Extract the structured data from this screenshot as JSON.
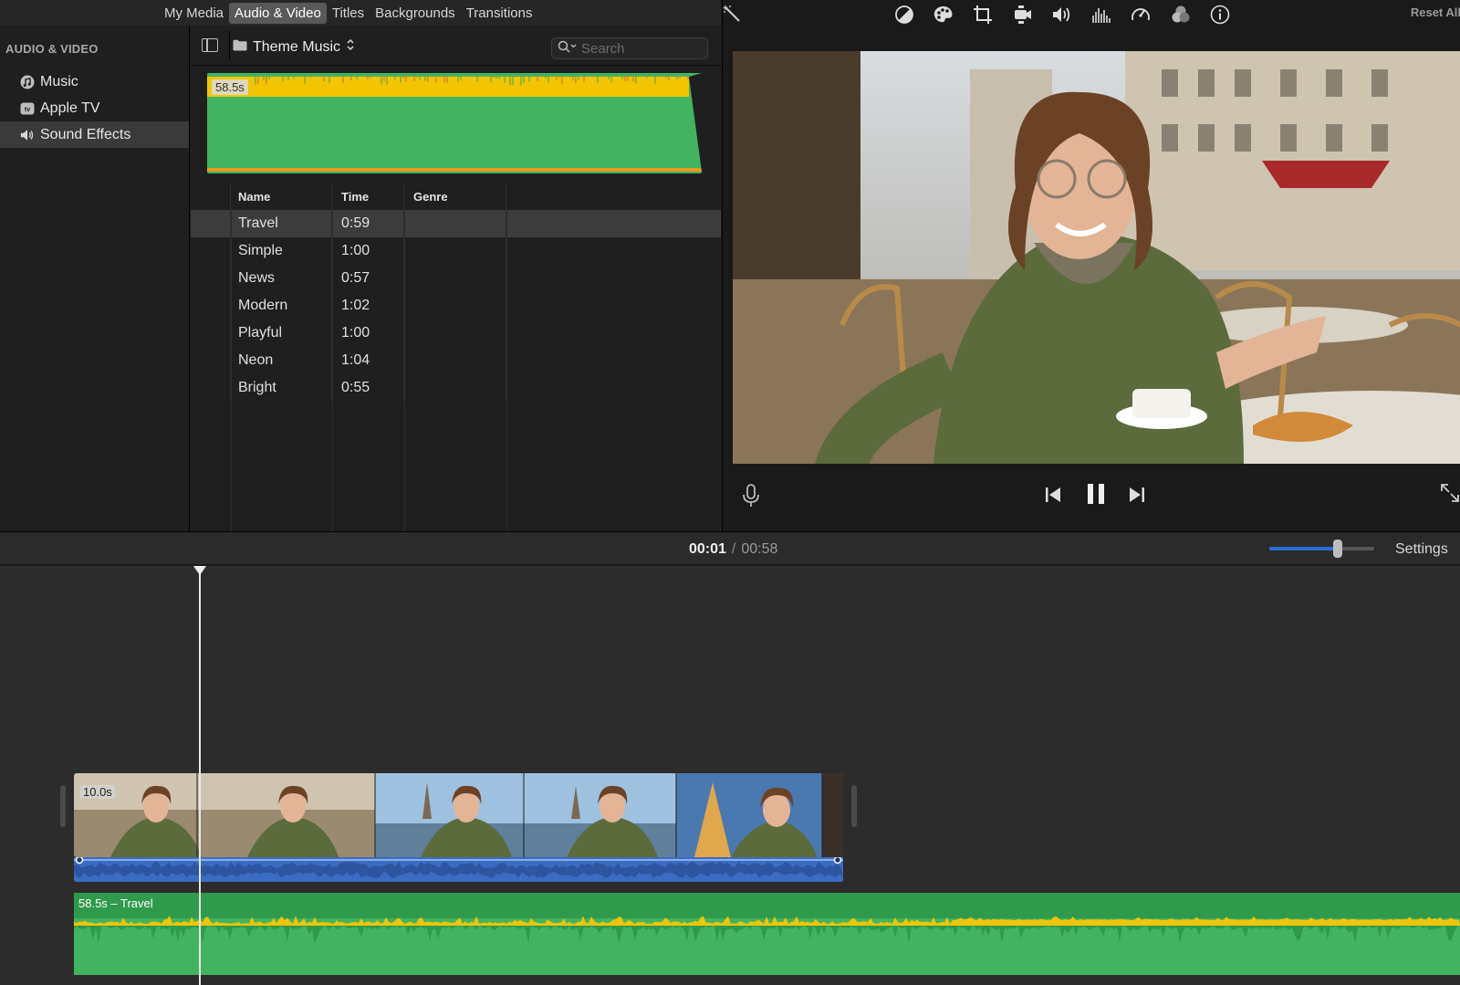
{
  "top_tabs": [
    {
      "label": "My Media",
      "active": false
    },
    {
      "label": "Audio & Video",
      "active": true
    },
    {
      "label": "Titles",
      "active": false
    },
    {
      "label": "Backgrounds",
      "active": false
    },
    {
      "label": "Transitions",
      "active": false
    }
  ],
  "sidebar": {
    "header": "AUDIO & VIDEO",
    "items": [
      {
        "label": "Music",
        "icon": "music-note-icon",
        "selected": false
      },
      {
        "label": "Apple TV",
        "icon": "apple-tv-icon",
        "selected": false
      },
      {
        "label": "Sound Effects",
        "icon": "speaker-icon",
        "selected": true
      }
    ]
  },
  "browser": {
    "folder": "Theme Music",
    "search_placeholder": "Search",
    "preview_duration": "58.5s",
    "columns": [
      "Name",
      "Time",
      "Genre"
    ],
    "rows": [
      {
        "name": "Travel",
        "time": "0:59",
        "genre": "",
        "selected": true
      },
      {
        "name": "Simple",
        "time": "1:00",
        "genre": "",
        "selected": false
      },
      {
        "name": "News",
        "time": "0:57",
        "genre": "",
        "selected": false
      },
      {
        "name": "Modern",
        "time": "1:02",
        "genre": "",
        "selected": false
      },
      {
        "name": "Playful",
        "time": "1:00",
        "genre": "",
        "selected": false
      },
      {
        "name": "Neon",
        "time": "1:04",
        "genre": "",
        "selected": false
      },
      {
        "name": "Bright",
        "time": "0:55",
        "genre": "",
        "selected": false
      }
    ]
  },
  "viewer": {
    "tools": [
      "magic-wand-icon",
      "color-balance-icon",
      "color-palette-icon",
      "crop-icon",
      "stabilization-camera-icon",
      "volume-icon",
      "equalizer-icon",
      "speed-icon",
      "filter-overlay-icon",
      "info-icon"
    ],
    "reset_all": "Reset All"
  },
  "timeline": {
    "current_time": "00:01",
    "separator": "/",
    "total_time": "00:58",
    "zoom_level": 0.65,
    "settings_label": "Settings",
    "clip_duration": "10.0s",
    "music_label": "58.5s – Travel"
  },
  "colors": {
    "accent_blue": "#2c6fd6",
    "audio_green": "#42b360",
    "waveform_yellow": "#f2c500",
    "clip_audio_blue": "#3b6cc4"
  }
}
